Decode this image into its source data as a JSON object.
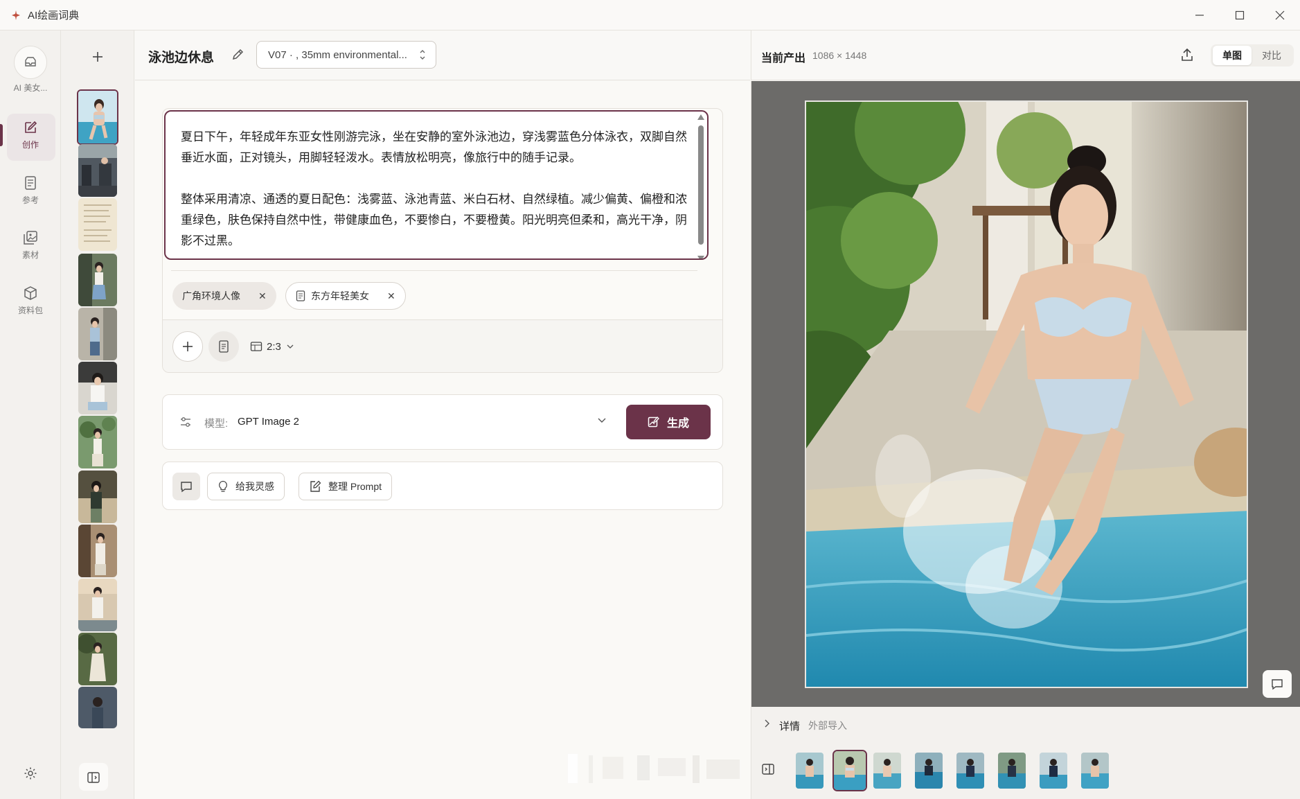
{
  "app": {
    "title": "AI绘画词典",
    "window_controls": [
      "minimize-icon",
      "maximize-icon",
      "close-icon"
    ]
  },
  "rail": {
    "items": [
      {
        "label": "AI 美女...",
        "icon": "folder-icon"
      },
      {
        "label": "创作",
        "icon": "edit-icon",
        "active": true
      },
      {
        "label": "参考",
        "icon": "document-icon"
      },
      {
        "label": "素材",
        "icon": "images-icon"
      },
      {
        "label": "资料包",
        "icon": "package-icon"
      }
    ],
    "settings_icon": "gear-icon"
  },
  "thumbnails": {
    "add_icon": "plus-icon",
    "count_visible": 12,
    "selected_index": 0
  },
  "editor": {
    "title": "泳池边休息",
    "version_select": "V07 · , 35mm environmental...",
    "prompt_paragraphs": [
      "夏日下午，年轻成年东亚女性刚游完泳，坐在安静的室外泳池边，穿浅雾蓝色分体泳衣，双脚自然垂近水面，正对镜头，用脚轻轻泼水。表情放松明亮，像旅行中的随手记录。",
      "整体采用清凉、通透的夏日配色：浅雾蓝、泳池青蓝、米白石材、自然绿植。减少偏黄、偏橙和浓重绿色，肤色保持自然中性，带健康血色，不要惨白，不要橙黄。阳光明亮但柔和，高光干净，阴影不过黑。"
    ],
    "tags": [
      {
        "label": "广角环境人像"
      },
      {
        "label": "东方年轻美女",
        "icon": "document-icon"
      }
    ],
    "aspect_ratio": "2:3",
    "model": {
      "label": "模型:",
      "value": "GPT Image 2"
    },
    "generate_label": "生成",
    "tools": {
      "inspire_label": "给我灵感",
      "tidy_label": "整理 Prompt"
    }
  },
  "output": {
    "title": "当前产出",
    "size": "1086 × 1448",
    "view_single": "单图",
    "view_compare": "对比",
    "details_label": "详情",
    "details_source": "外部导入",
    "filmstrip_count": 8,
    "filmstrip_selected": 1
  },
  "colors": {
    "accent": "#6b3349",
    "pool_blue": "#2f97b8",
    "background": "#f7f6f3"
  }
}
